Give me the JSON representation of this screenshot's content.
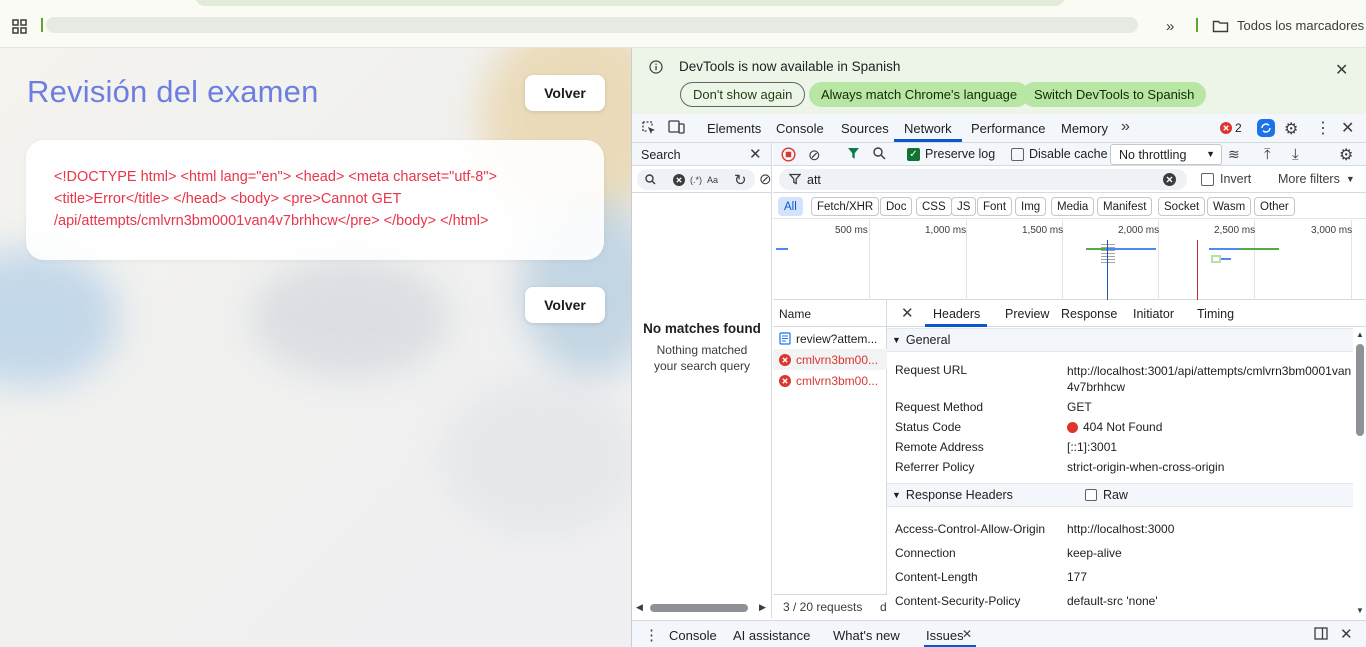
{
  "bookmarks_bar": {
    "all_bookmarks": "Todos los marcadores"
  },
  "page": {
    "title": "Revisión del examen",
    "back_label": "Volver",
    "error_text": "<!DOCTYPE html> <html lang=\"en\"> <head> <meta charset=\"utf-8\"> <title>Error</title> </head> <body> <pre>Cannot GET /api/attempts/cmlvrn3bm0001van4v7brhhcw</pre> </body> </html>"
  },
  "devtools": {
    "infobar": {
      "message": "DevTools is now available in Spanish",
      "dont_show": "Don't show again",
      "match_language": "Always match Chrome's language",
      "switch_spanish": "Switch DevTools to Spanish"
    },
    "tabs": [
      "Elements",
      "Console",
      "Sources",
      "Network",
      "Performance",
      "Memory"
    ],
    "active_tab": "Network",
    "issues_count": "2",
    "search": {
      "title": "Search",
      "regex_label": "(.*)",
      "case_label": "Aa",
      "no_matches": "No matches found",
      "no_matches_sub": "Nothing matched your search query"
    },
    "network": {
      "preserve_log": "Preserve log",
      "disable_cache": "Disable cache",
      "throttling": "No throttling",
      "filter_value": "att",
      "invert": "Invert",
      "more_filters": "More filters",
      "type_filters": [
        "All",
        "Fetch/XHR",
        "Doc",
        "CSS",
        "JS",
        "Font",
        "Img",
        "Media",
        "Manifest",
        "Socket",
        "Wasm",
        "Other"
      ],
      "timeline_labels": [
        "500 ms",
        "1,000 ms",
        "1,500 ms",
        "2,000 ms",
        "2,500 ms",
        "3,000 ms"
      ],
      "name_header": "Name",
      "requests": [
        {
          "name": "review?attem...",
          "status": "ok"
        },
        {
          "name": "cmlvrn3bm00...",
          "status": "error"
        },
        {
          "name": "cmlvrn3bm00...",
          "status": "error"
        }
      ],
      "status_bar": "3 / 20 requests",
      "status_bar_more": "d"
    },
    "details": {
      "tabs": [
        "Headers",
        "Preview",
        "Response",
        "Initiator",
        "Timing"
      ],
      "active_tab": "Headers",
      "general_title": "General",
      "general": [
        {
          "key": "Request URL",
          "value": "http://localhost:3001/api/attempts/cmlvrn3bm0001van4v7brhhcw"
        },
        {
          "key": "Request Method",
          "value": "GET"
        },
        {
          "key": "Status Code",
          "value": "404 Not Found"
        },
        {
          "key": "Remote Address",
          "value": "[::1]:3001"
        },
        {
          "key": "Referrer Policy",
          "value": "strict-origin-when-cross-origin"
        }
      ],
      "response_title": "Response Headers",
      "raw_label": "Raw",
      "response": [
        {
          "key": "Access-Control-Allow-Origin",
          "value": "http://localhost:3000"
        },
        {
          "key": "Connection",
          "value": "keep-alive"
        },
        {
          "key": "Content-Length",
          "value": "177"
        },
        {
          "key": "Content-Security-Policy",
          "value": "default-src 'none'"
        }
      ]
    },
    "drawer": {
      "tabs": [
        "Console",
        "AI assistance",
        "What's new",
        "Issues"
      ],
      "active_tab": "Issues"
    },
    "colors": {
      "accent": "#0b57d0",
      "error": "#dc362e",
      "infobar_bg": "#edf5e8",
      "infobar_button": "#b8e6a4"
    }
  }
}
